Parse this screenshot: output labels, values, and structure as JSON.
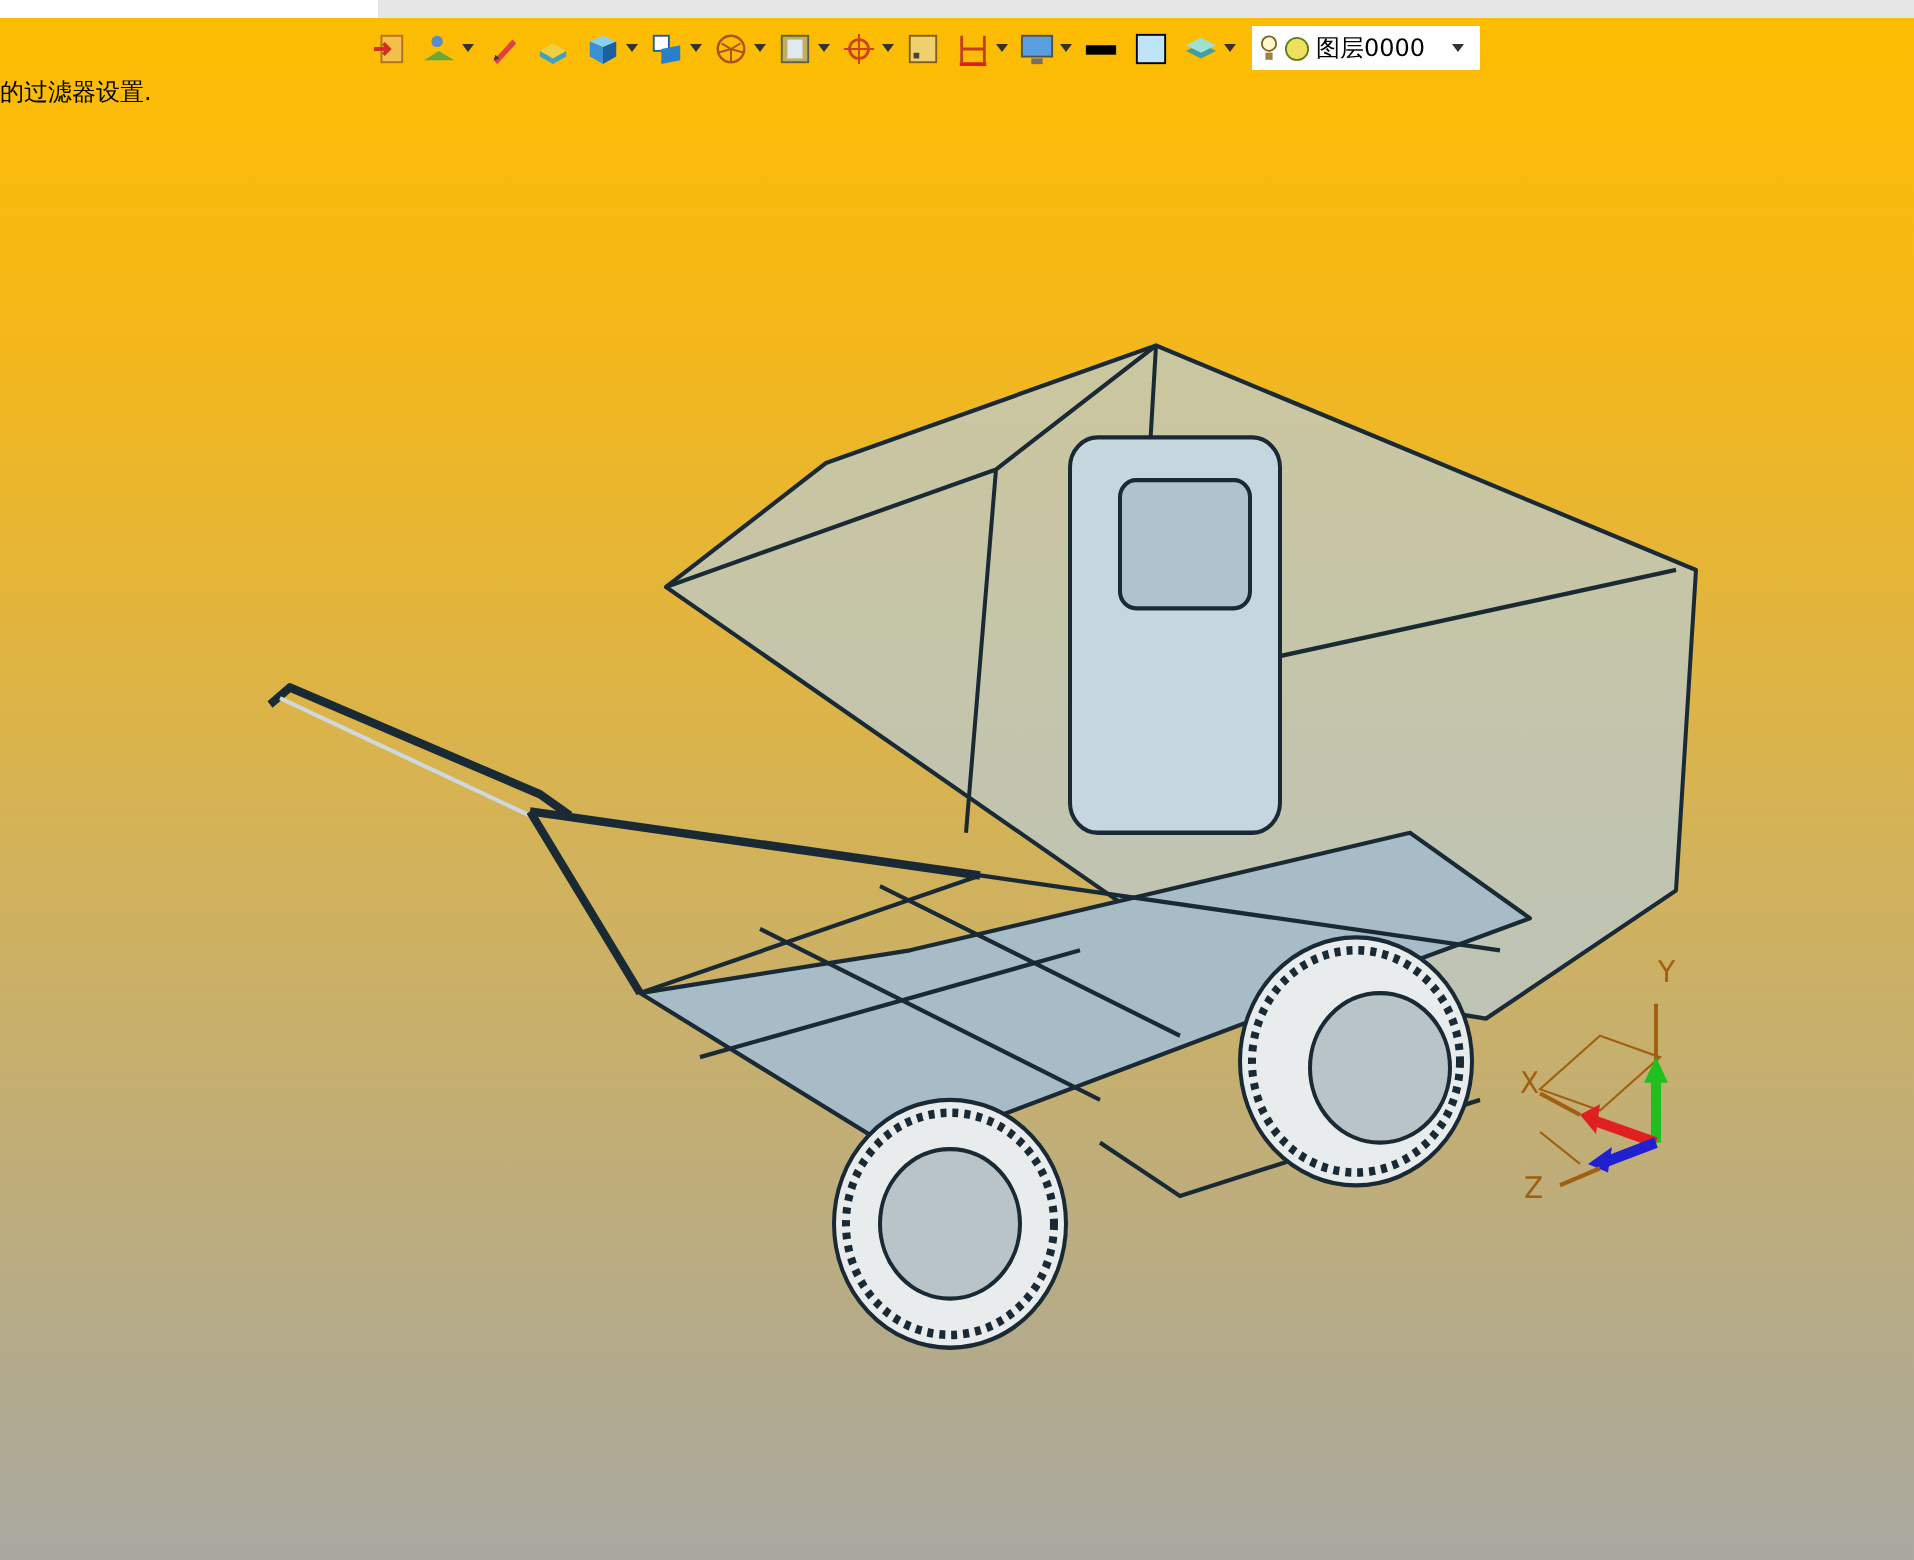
{
  "toolbar": [
    {
      "kind": "exit",
      "dropdown": false
    },
    {
      "kind": "sketch",
      "dropdown": true
    },
    {
      "kind": "pen",
      "dropdown": false
    },
    {
      "kind": "extrude",
      "dropdown": false
    },
    {
      "kind": "cube",
      "dropdown": true
    },
    {
      "kind": "view",
      "dropdown": true
    },
    {
      "kind": "sphere",
      "dropdown": true
    },
    {
      "kind": "frame",
      "dropdown": true
    },
    {
      "kind": "target",
      "dropdown": true
    },
    {
      "kind": "square",
      "dropdown": false
    },
    {
      "kind": "dimension",
      "dropdown": true
    },
    {
      "kind": "monitor",
      "dropdown": true
    },
    {
      "kind": "line",
      "dropdown": false
    },
    {
      "kind": "fill",
      "dropdown": false
    },
    {
      "kind": "layers",
      "dropdown": true
    }
  ],
  "layer_selector": {
    "value": "图层0000"
  },
  "status_message": "的过滤器设置.",
  "axis_labels": {
    "x": "X",
    "y": "Y",
    "z": "Z"
  }
}
